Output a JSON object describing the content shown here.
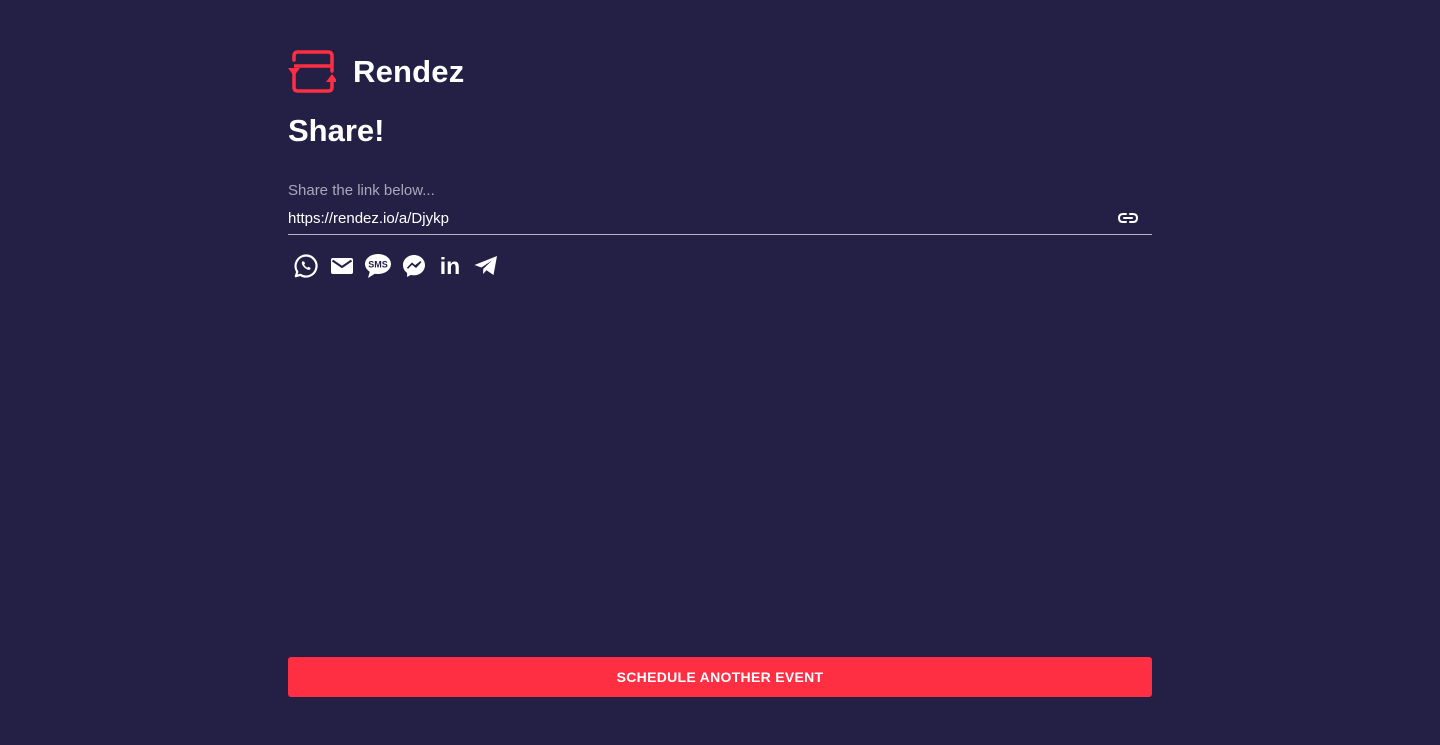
{
  "brand": {
    "name": "Rendez",
    "logo_icon": "calendar-sync-icon",
    "accent_color": "#fe2e43"
  },
  "page": {
    "title": "Share!",
    "background_color": "#241f44"
  },
  "share_link": {
    "label": "Share the link below...",
    "value": "https://rendez.io/a/Djykp",
    "copy_icon": "link-icon"
  },
  "share_options": [
    {
      "icon": "whatsapp-icon"
    },
    {
      "icon": "email-icon"
    },
    {
      "icon": "sms-icon",
      "icon_text": "SMS"
    },
    {
      "icon": "messenger-icon"
    },
    {
      "icon": "linkedin-icon",
      "icon_text": "in"
    },
    {
      "icon": "telegram-icon"
    }
  ],
  "cta": {
    "label": "SCHEDULE ANOTHER EVENT"
  }
}
